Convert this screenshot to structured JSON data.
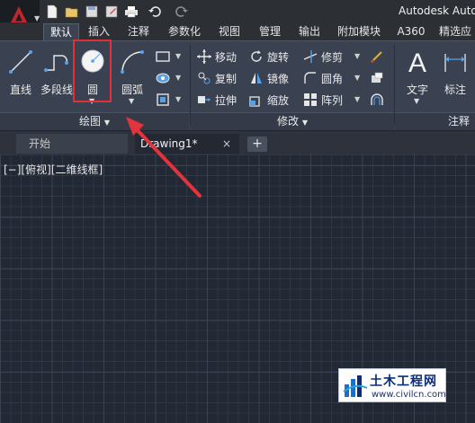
{
  "app": {
    "title": "Autodesk Auto",
    "accent_color": "#c0262b"
  },
  "qat": {
    "items": [
      "new-file-icon",
      "open-folder-icon",
      "save-icon",
      "save-as-icon",
      "print-icon",
      "undo-icon",
      "redo-icon"
    ]
  },
  "ribbon": {
    "tabs": [
      {
        "label": "默认",
        "active": true
      },
      {
        "label": "插入"
      },
      {
        "label": "注释"
      },
      {
        "label": "参数化"
      },
      {
        "label": "视图"
      },
      {
        "label": "管理"
      },
      {
        "label": "输出"
      },
      {
        "label": "附加模块"
      },
      {
        "label": "A360"
      },
      {
        "label": "精选应"
      }
    ],
    "draw_panel": {
      "title": "绘图",
      "tools": {
        "line": "直线",
        "polyline": "多段线",
        "circle": "圆",
        "arc": "圆弧"
      }
    },
    "modify_panel": {
      "title": "修改",
      "tools": {
        "move": "移动",
        "rotate": "旋转",
        "trim": "修剪",
        "copy": "复制",
        "mirror": "镜像",
        "fillet": "圆角",
        "stretch": "拉伸",
        "scale": "缩放",
        "array": "阵列"
      }
    },
    "annotation_panel": {
      "title": "注释",
      "tools": {
        "text": "文字",
        "dimension": "标注"
      }
    }
  },
  "doc_tabs": {
    "start": "开始",
    "drawing": "Drawing1*",
    "close": "×",
    "add": "+"
  },
  "viewport": {
    "label": "[−][俯视][二维线框]"
  },
  "watermark": {
    "title": "土木工程网",
    "url": "www.civilcn.com"
  },
  "colors": {
    "highlight": "#e0303a",
    "canvas": "#222834",
    "ribbon": "#3a4150"
  }
}
